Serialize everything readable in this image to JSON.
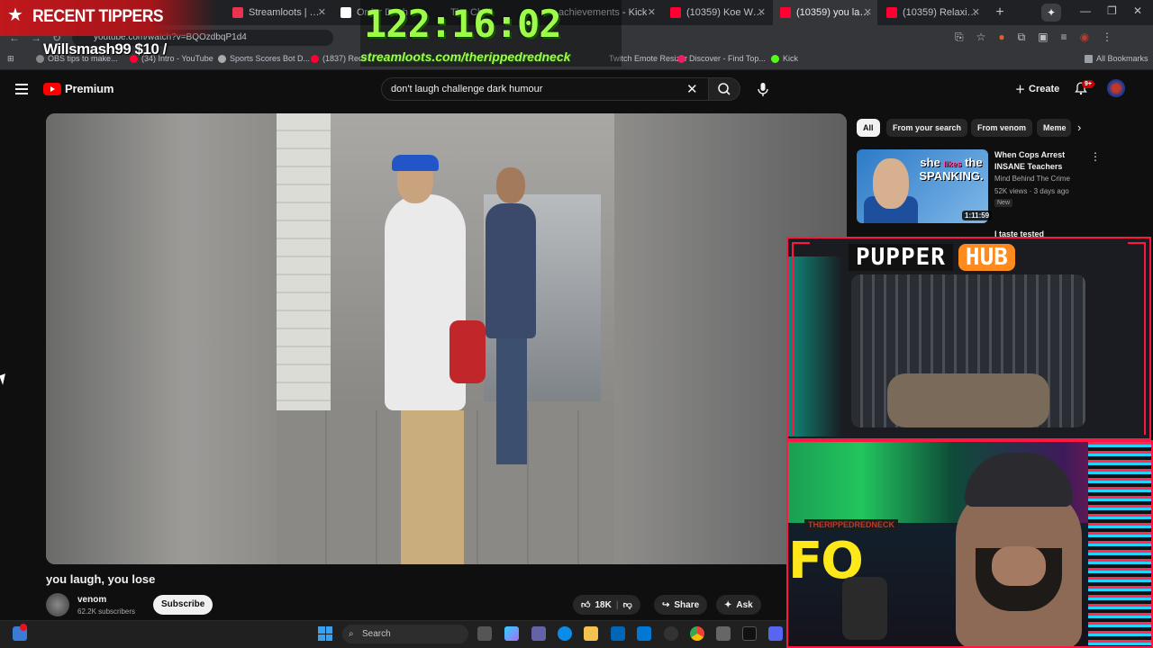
{
  "browser": {
    "tabs": [
      {
        "label": "",
        "active": false
      },
      {
        "label": "Streamloots | Therip",
        "active": false
      },
      {
        "label": "Order Dash",
        "active": false
      },
      {
        "label": "The Chall",
        "active": false
      },
      {
        "label": "achievements - Kick",
        "active": false
      },
      {
        "label": "(10359) Koe Wetzel",
        "active": false
      },
      {
        "label": "(10359) you laug",
        "active": true
      },
      {
        "label": "(10359) Relaxing Car",
        "active": false
      }
    ],
    "url": "youtube.com/watch?v=BQOzdbqP1d4",
    "bookmarks": [
      "OBS tips to make...",
      "(34) Intro - YouTube",
      "Sports Scores Bot D...",
      "(1837) Redm",
      "Twitch Emote Resizer",
      "Discover - Find Top...",
      "Kick",
      "All Bookmarks"
    ]
  },
  "youtube": {
    "logo_text": "Premium",
    "search_query": "don't laugh challenge dark humour",
    "create_label": "Create",
    "notif_count": "9+",
    "video_title": "you laugh, you lose",
    "channel_name": "venom",
    "subscriber_count": "62.2K subscribers",
    "subscribe_label": "Subscribe",
    "like_count": "18K",
    "share_label": "Share",
    "ask_label": "Ask",
    "chips": [
      "All",
      "From your search",
      "From venom",
      "Meme"
    ],
    "suggestions": [
      {
        "title": "When Cops Arrest INSANE Teachers",
        "channel": "Mind Behind The Crime",
        "meta": "52K views · 3 days ago",
        "badge": "New",
        "duration": "1:11:59",
        "thumb_text_1": "she",
        "thumb_text_2": "likes",
        "thumb_text_3": "the",
        "thumb_text_4": "SPANKING."
      },
      {
        "title": "I taste tested"
      }
    ]
  },
  "overlay": {
    "recent_tippers_label": "RECENT TIPPERS",
    "tipper": "Willsmash99 $10 /",
    "timer": "122:16:02",
    "streamloots_url": "streamloots.com/therippedredneck",
    "pupper_label_1": "PUPPER",
    "pupper_label_2": "HUB",
    "facecam_banner": "THERIPPEDREDNECK",
    "facecam_sign": "FO"
  },
  "taskbar": {
    "search_label": "Search"
  },
  "colors": {
    "yt_red": "#ff0000",
    "timer_green": "#9dfc4a",
    "overlay_red": "#ff1744",
    "pupper_orange": "#ff8a1e"
  }
}
